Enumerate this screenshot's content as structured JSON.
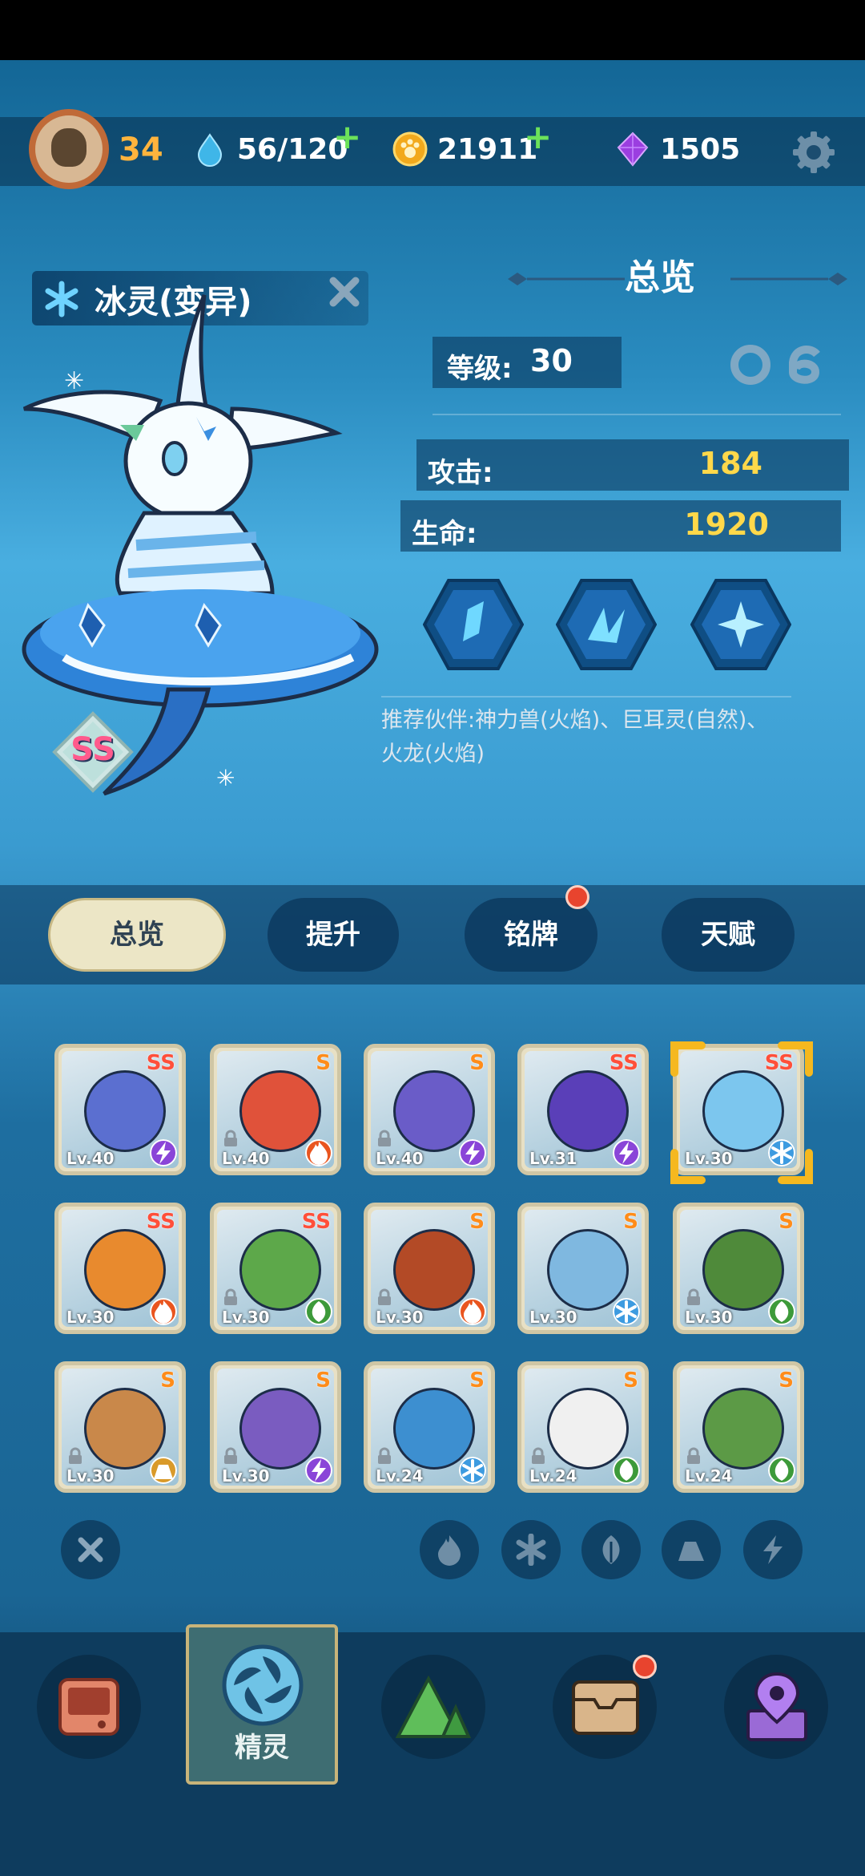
{
  "header": {
    "player_level": "34",
    "stamina": "56/120",
    "coins": "21911",
    "gems": "1505"
  },
  "pet": {
    "name": "冰灵(变异)",
    "grade": "SS"
  },
  "overview": {
    "title": "总览",
    "level_label": "等级:",
    "level_value": "30",
    "attack_label": "攻击:",
    "attack_value": "184",
    "hp_label": "生命:",
    "hp_value": "1920",
    "partners_text": "推荐伙伴:神力兽(火焰)、巨耳灵(自然)、火龙(火焰)"
  },
  "tabs": [
    {
      "label": "总览",
      "active": true
    },
    {
      "label": "提升",
      "active": false
    },
    {
      "label": "铭牌",
      "active": false,
      "badge": true
    },
    {
      "label": "天赋",
      "active": false
    }
  ],
  "roster": [
    {
      "level": "Lv.40",
      "rank": "SS",
      "element": "electric",
      "locked": false,
      "color": "#5b6fd0"
    },
    {
      "level": "Lv.40",
      "rank": "S",
      "element": "fire",
      "locked": true,
      "color": "#e0523a"
    },
    {
      "level": "Lv.40",
      "rank": "S",
      "element": "electric",
      "locked": true,
      "color": "#6a5cc8"
    },
    {
      "level": "Lv.31",
      "rank": "SS",
      "element": "electric",
      "locked": false,
      "color": "#5a3fb8"
    },
    {
      "level": "Lv.30",
      "rank": "SS",
      "element": "ice",
      "locked": false,
      "color": "#7cc6ee"
    },
    {
      "level": "Lv.30",
      "rank": "SS",
      "element": "fire",
      "locked": false,
      "color": "#e88a2e"
    },
    {
      "level": "Lv.30",
      "rank": "SS",
      "element": "nature",
      "locked": true,
      "color": "#5da84a"
    },
    {
      "level": "Lv.30",
      "rank": "S",
      "element": "fire",
      "locked": true,
      "color": "#b34a26"
    },
    {
      "level": "Lv.30",
      "rank": "S",
      "element": "ice",
      "locked": false,
      "color": "#7fb8e0"
    },
    {
      "level": "Lv.30",
      "rank": "S",
      "element": "nature",
      "locked": true,
      "color": "#4f8a3a"
    },
    {
      "level": "Lv.30",
      "rank": "S",
      "element": "earth",
      "locked": true,
      "color": "#c9884a"
    },
    {
      "level": "Lv.30",
      "rank": "S",
      "element": "electric",
      "locked": true,
      "color": "#7a5cc0"
    },
    {
      "level": "Lv.24",
      "rank": "S",
      "element": "ice",
      "locked": true,
      "color": "#3d8fd0"
    },
    {
      "level": "Lv.24",
      "rank": "S",
      "element": "nature",
      "locked": true,
      "color": "#f0f0f0"
    },
    {
      "level": "Lv.24",
      "rank": "S",
      "element": "nature",
      "locked": true,
      "color": "#5c9a46"
    }
  ],
  "element_colors": {
    "fire": "#e9551f",
    "ice": "#3d9be0",
    "nature": "#3d9a3a",
    "electric": "#8a45d8",
    "earth": "#d99a2a"
  },
  "nav": {
    "active_label": "精灵"
  }
}
